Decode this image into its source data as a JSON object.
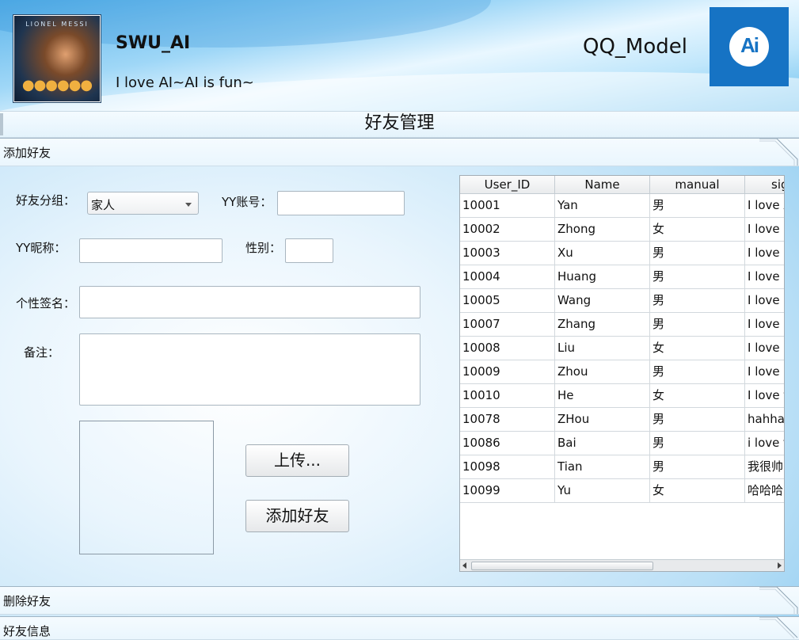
{
  "header": {
    "username": "SWU_AI",
    "motto": "I love AI~AI is fun~",
    "model_name": "QQ_Model",
    "avatar_text": "LIONEL MESSI",
    "logo_text": "Ai"
  },
  "title": "好友管理",
  "sections": {
    "add": "添加好友",
    "delete": "删除好友",
    "info": "好友信息"
  },
  "form": {
    "group_label": "好友分组：",
    "group_value": "家人",
    "account_label": "YY账号：",
    "nickname_label": "YY昵称：",
    "gender_label": "性别：",
    "signature_label": "个性签名：",
    "note_label": "备注：",
    "upload_button": "上传...",
    "add_button": "添加好友"
  },
  "table": {
    "columns": [
      "User_ID",
      "Name",
      "manual",
      "signature"
    ],
    "rows": [
      [
        "10001",
        "Yan",
        "男",
        "I love AI"
      ],
      [
        "10002",
        "Zhong",
        "女",
        "I love reading"
      ],
      [
        "10003",
        "Xu",
        "男",
        "I love ..."
      ],
      [
        "10004",
        "Huang",
        "男",
        "I love music"
      ],
      [
        "10005",
        "Wang",
        "男",
        "I love python"
      ],
      [
        "10007",
        "Zhang",
        "男",
        "I love eating"
      ],
      [
        "10008",
        "Liu",
        "女",
        "I love coding"
      ],
      [
        "10009",
        "Zhou",
        "男",
        "I love cooking"
      ],
      [
        "10010",
        "He",
        "女",
        "I love football"
      ],
      [
        "10078",
        "ZHou",
        "男",
        "hahha"
      ],
      [
        "10086",
        "Bai",
        "男",
        "i love fun"
      ],
      [
        "10098",
        "Tian",
        "男",
        "我很帅"
      ],
      [
        "10099",
        "Yu",
        "女",
        "哈哈哈"
      ]
    ]
  },
  "colors": {
    "logo_bg": "#1673c4",
    "header_sky": "#6cc0ee"
  }
}
